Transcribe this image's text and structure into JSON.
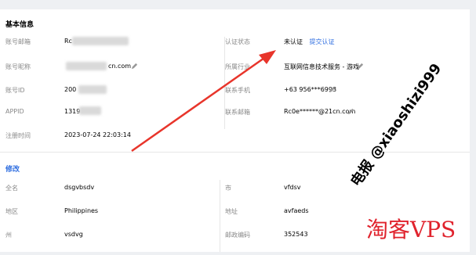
{
  "basic_info": {
    "title": "基本信息",
    "left": [
      {
        "label": "账号邮箱",
        "value": "Rc"
      },
      {
        "label": "账号昵称",
        "value": "cn.com"
      },
      {
        "label": "账号ID",
        "value": "200"
      },
      {
        "label": "APPID",
        "value": "1319"
      },
      {
        "label": "注册时间",
        "value": "2023-07-24 22:03:14"
      }
    ],
    "right": [
      {
        "label": "认证状态",
        "value": "未认证",
        "link": "提交认证"
      },
      {
        "label": "所属行业",
        "value": "互联网信息技术服务 - 游戏"
      },
      {
        "label": "联系手机",
        "value": "+63 956***6993"
      },
      {
        "label": "联系邮箱",
        "value": "Rc0e******@21cn.com"
      }
    ]
  },
  "edit": {
    "title": "修改",
    "left": [
      {
        "label": "全名",
        "value": "dsgvbsdv"
      },
      {
        "label": "地区",
        "value": "Philippines"
      },
      {
        "label": "州",
        "value": "vsdvg"
      }
    ],
    "right": [
      {
        "label": "市",
        "value": "vfdsv"
      },
      {
        "label": "地址",
        "value": "avfaeds"
      },
      {
        "label": "邮政编码",
        "value": "352543"
      }
    ]
  },
  "watermark": {
    "telegram": "电报 @xiaoshizi999",
    "brand": "淘客VPS"
  },
  "colors": {
    "accent": "#2f6ee0",
    "arrow": "#e8352b",
    "brand": "#e0232d"
  },
  "icons": {
    "edit": "pencil-icon"
  }
}
